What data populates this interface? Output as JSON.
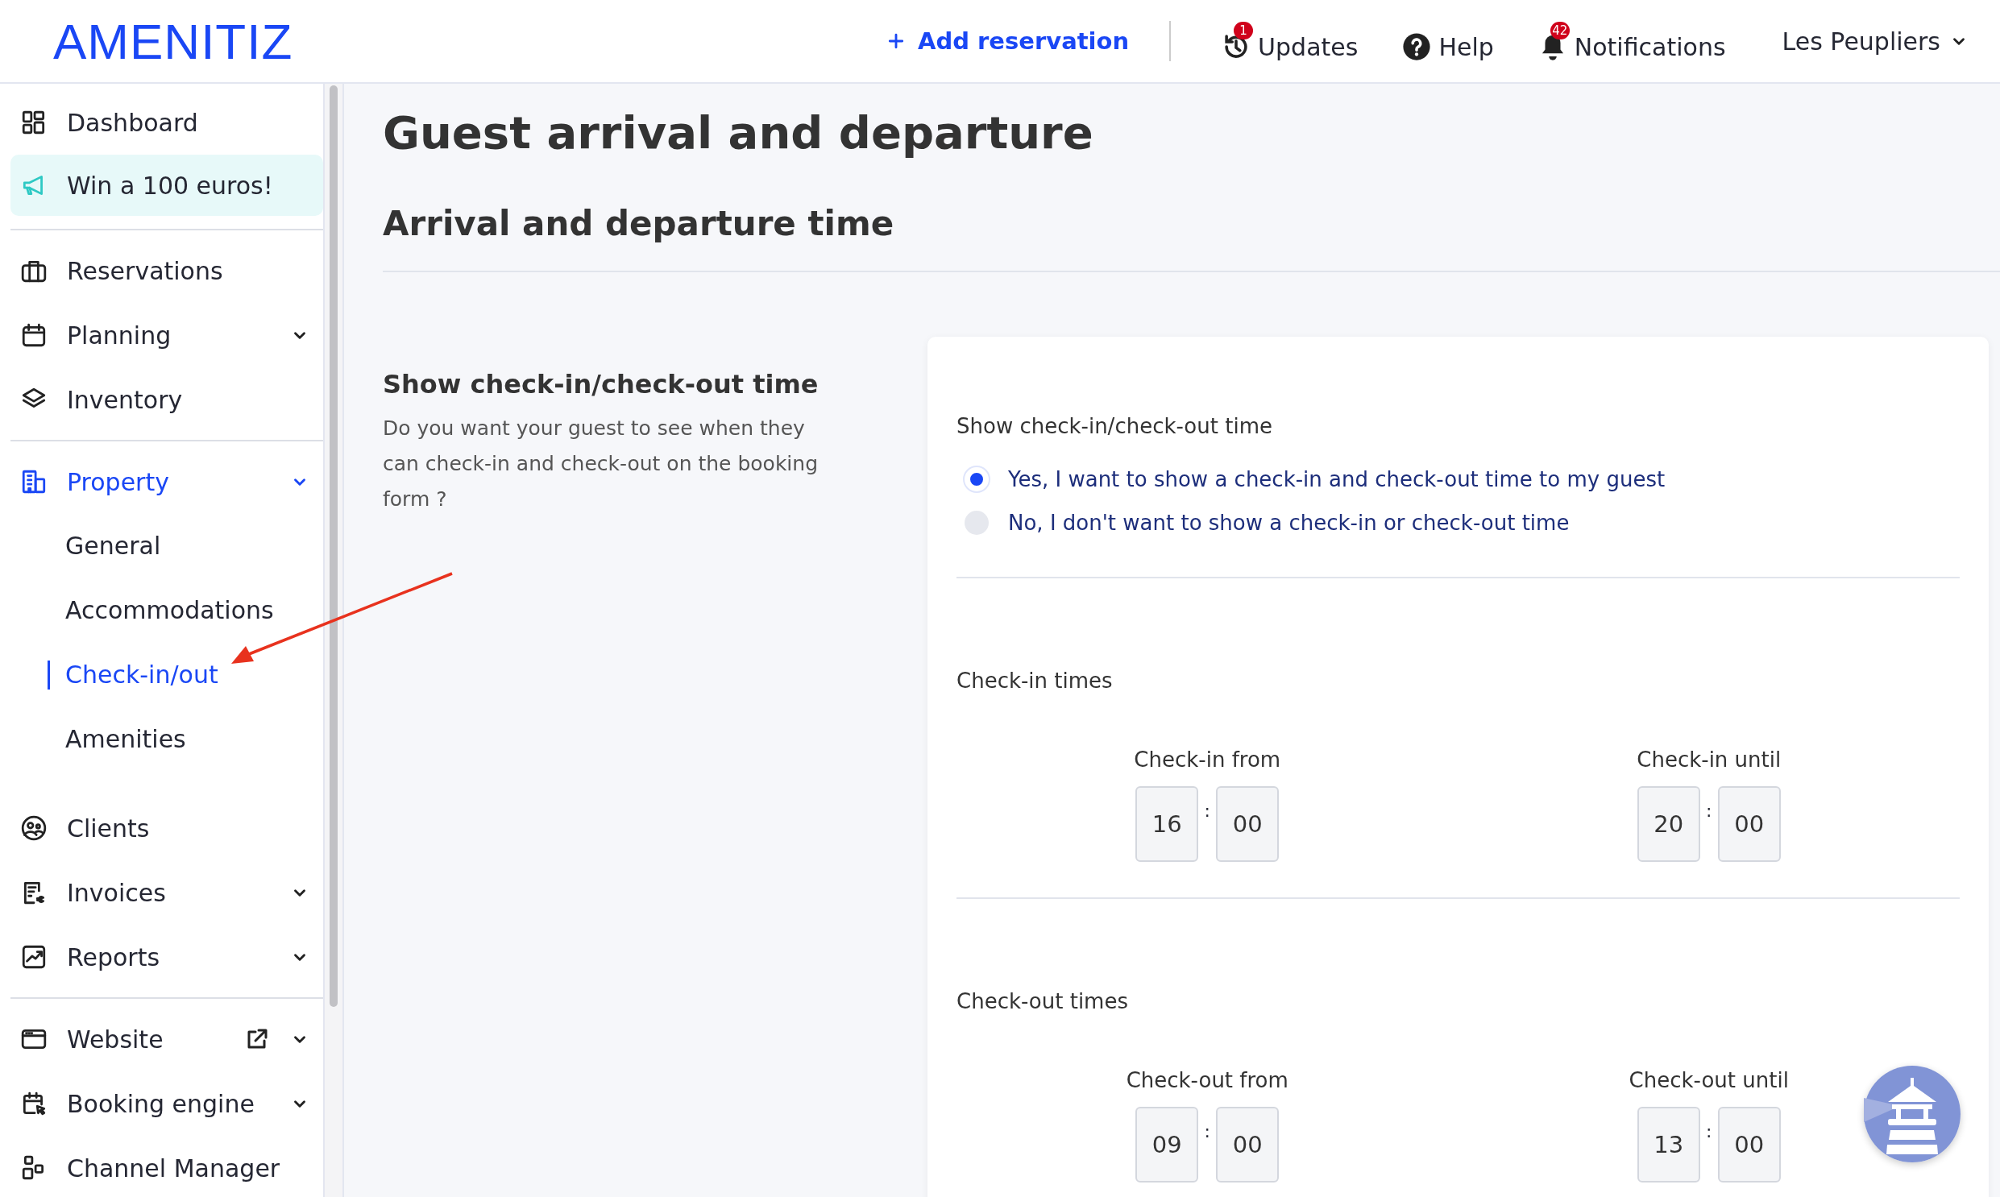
{
  "header": {
    "logo": "AMENITIZ",
    "add_reservation": "Add reservation",
    "links": [
      {
        "kind": "updates",
        "label": "Updates",
        "badge": "1"
      },
      {
        "kind": "help",
        "label": "Help"
      },
      {
        "kind": "notifications",
        "label": "Notifications",
        "badge": "42"
      }
    ],
    "account": "Les Peupliers"
  },
  "sidebar": {
    "groups": [
      [
        {
          "kind": "item",
          "label": "Dashboard",
          "selected": false,
          "chevron": false
        },
        {
          "kind": "promo",
          "label": "Win a 100 euros!",
          "selected": false,
          "chevron": false
        }
      ],
      [
        {
          "kind": "item",
          "label": "Reservations",
          "selected": false,
          "chevron": false
        },
        {
          "kind": "item",
          "label": "Planning",
          "selected": false,
          "chevron": true
        },
        {
          "kind": "item",
          "label": "Inventory",
          "selected": false,
          "chevron": false
        }
      ],
      [
        {
          "kind": "item",
          "label": "Property",
          "selected": true,
          "chevron": true,
          "children": [
            {
              "label": "General",
              "selected": false
            },
            {
              "label": "Accommodations",
              "selected": false
            },
            {
              "label": "Check-in/out",
              "selected": true
            },
            {
              "label": "Amenities",
              "selected": false
            }
          ]
        },
        {
          "kind": "item",
          "label": "Clients",
          "selected": false,
          "chevron": false
        },
        {
          "kind": "item",
          "label": "Invoices",
          "selected": false,
          "chevron": true
        },
        {
          "kind": "item",
          "label": "Reports",
          "selected": false,
          "chevron": true
        }
      ],
      [
        {
          "kind": "item",
          "label": "Website",
          "selected": false,
          "chevron": true,
          "external": true
        },
        {
          "kind": "item",
          "label": "Booking engine",
          "selected": false,
          "chevron": true
        },
        {
          "kind": "item",
          "label": "Channel Manager",
          "selected": false,
          "chevron": false
        }
      ]
    ]
  },
  "main": {
    "title": "Guest arrival and departure",
    "section_title": "Arrival and departure time",
    "setting": {
      "title": "Show check-in/check-out time",
      "description": "Do you want your guest to see when they can check-in and check-out on the booking form ?"
    },
    "card": {
      "question": "Show check-in/check-out time",
      "options": [
        {
          "label": "Yes, I want to show a check-in and check-out time to my guest",
          "selected": true
        },
        {
          "label": "No, I don't want to show a check-in or check-out time",
          "selected": false
        }
      ],
      "groups": [
        {
          "title": "Check-in times",
          "fields": [
            {
              "label": "Check-in from",
              "hours": "16",
              "separator": ":",
              "minutes": "00"
            },
            {
              "label": "Check-in until",
              "hours": "20",
              "separator": ":",
              "minutes": "00"
            }
          ]
        },
        {
          "title": "Check-out times",
          "fields": [
            {
              "label": "Check-out from",
              "hours": "09",
              "separator": ":",
              "minutes": "00"
            },
            {
              "label": "Check-out until",
              "hours": "13",
              "separator": ":",
              "minutes": "00"
            }
          ]
        }
      ]
    }
  }
}
